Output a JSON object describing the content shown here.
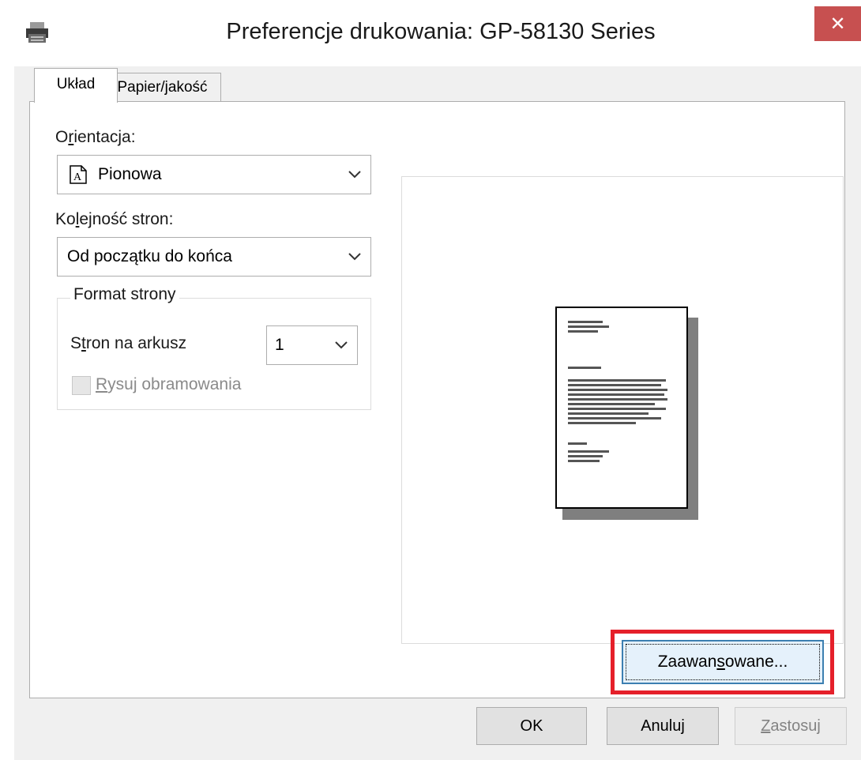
{
  "window": {
    "title": "Preferencje drukowania: GP-58130 Series",
    "close_symbol": "✕",
    "icon": "printer-icon"
  },
  "tabs": [
    {
      "label": "Układ",
      "active": true
    },
    {
      "label": "Papier/jakość",
      "active": false
    }
  ],
  "layout": {
    "orientation_label": {
      "pre": "O",
      "u": "r",
      "post": "ientacja:"
    },
    "orientation_value": "Pionowa",
    "page_order_label": {
      "pre": "Ko",
      "u": "l",
      "post": "ejność stron:"
    },
    "page_order_value": "Od początku do końca",
    "page_format_title": "Format strony",
    "pages_per_sheet_label": {
      "pre": "S",
      "u": "t",
      "post": "ron na arkusz"
    },
    "pages_per_sheet_value": "1",
    "draw_borders_label": {
      "pre": "",
      "u": "R",
      "post": "ysuj obramowania"
    },
    "draw_borders_checked": false
  },
  "buttons": {
    "advanced": {
      "pre": "Zaawan",
      "u": "s",
      "post": "owane..."
    },
    "ok": "OK",
    "cancel": "Anuluj",
    "apply": {
      "pre": "",
      "u": "Z",
      "post": "astosuj"
    }
  },
  "colors": {
    "highlight": "#e5202a",
    "close": "#c75050"
  }
}
